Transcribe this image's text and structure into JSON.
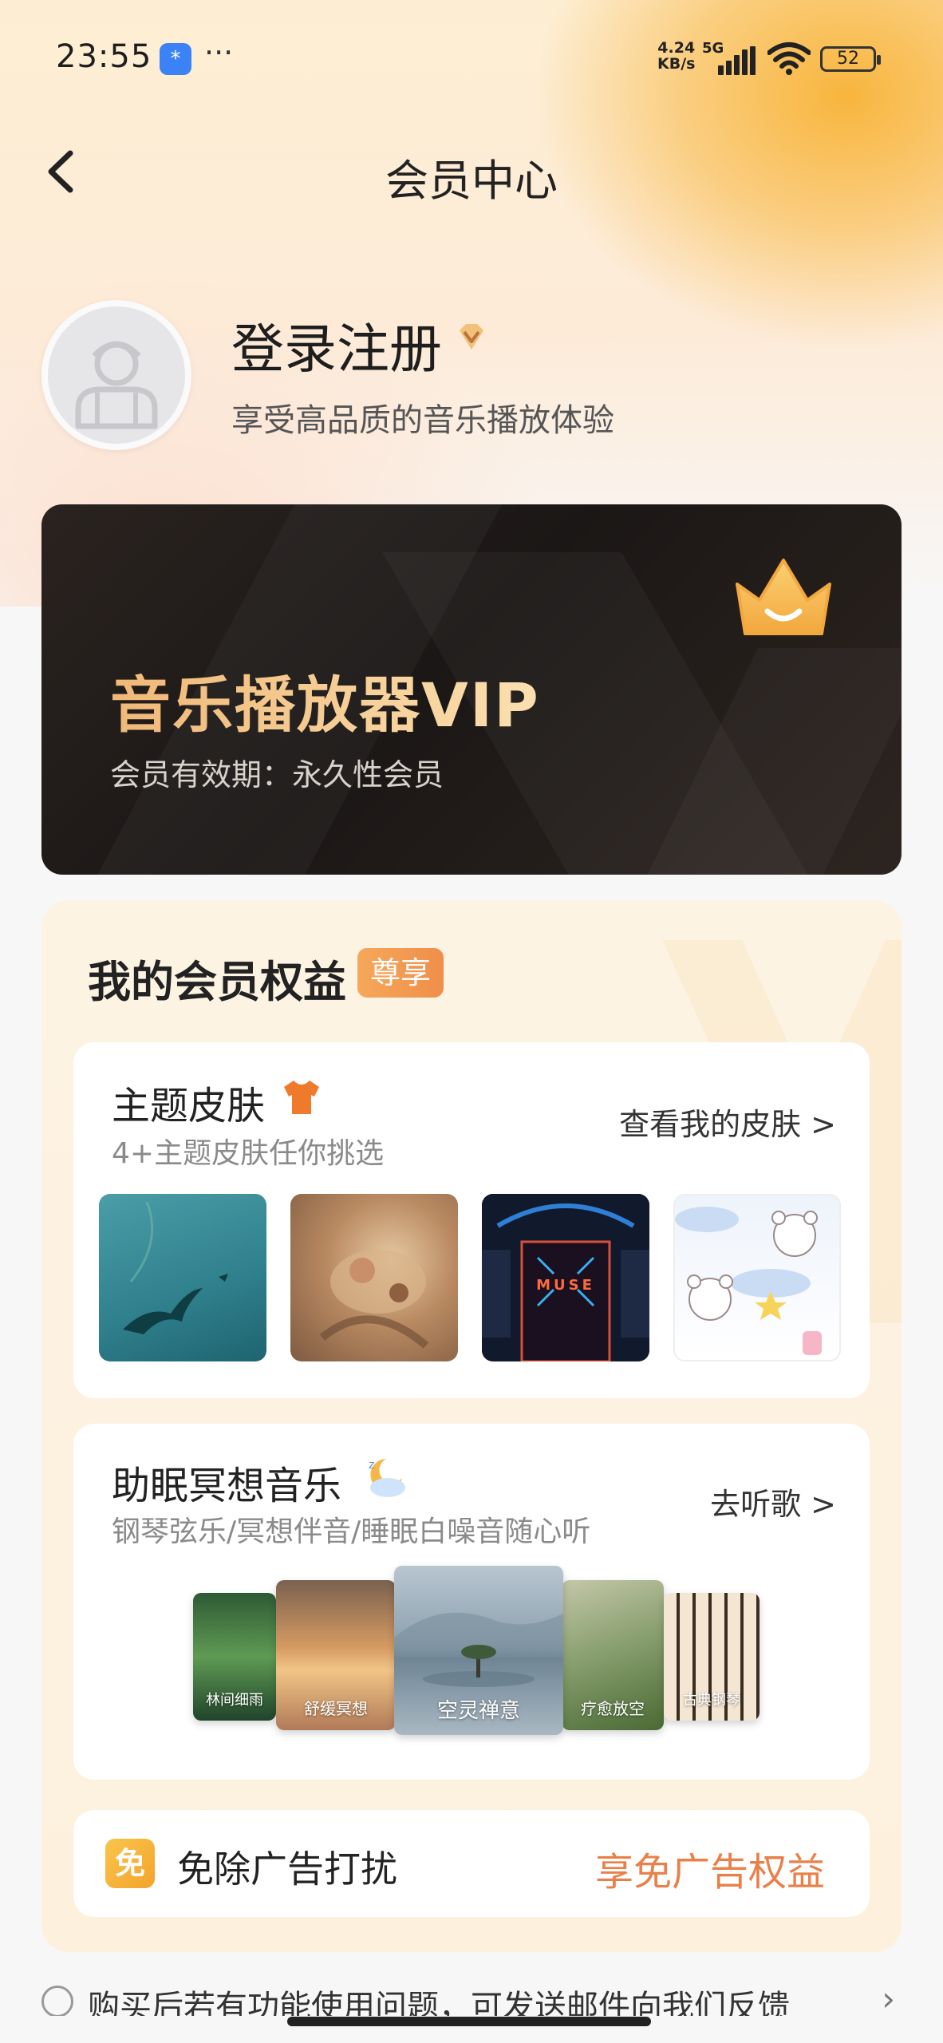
{
  "status_bar": {
    "time": "23:55",
    "dots": "···",
    "net_speed": "4.24",
    "net_unit": "KB/s",
    "network": "5G",
    "battery": "52",
    "app_icon": "*"
  },
  "header": {
    "title": "会员中心",
    "back_icon": "chevron-left-icon"
  },
  "profile": {
    "login_label": "登录注册",
    "subtitle": "享受高品质的音乐播放体验"
  },
  "vip_card": {
    "title": "音乐播放器VIP",
    "expiry": "会员有效期：永久性会员"
  },
  "benefits": {
    "title": "我的会员权益",
    "badge": "尊享",
    "skins": {
      "title": "主题皮肤",
      "subtitle": "4+主题皮肤任你挑选",
      "link": "查看我的皮肤 >",
      "thumbs_text": [
        "MUSE"
      ]
    },
    "sleep_music": {
      "title": "助眠冥想音乐",
      "subtitle": "钢琴弦乐/冥想伴音/睡眠白噪音随心听",
      "link": "去听歌 >",
      "covers": [
        "林间细雨",
        "舒缓冥想",
        "空灵禅意",
        "疗愈放空",
        "古典钢琴"
      ]
    },
    "ad_free": {
      "icon_text": "免",
      "label": "免除广告打扰",
      "link": "享免广告权益"
    }
  },
  "footer": {
    "tip": "购买后若有功能使用问题，可发送邮件向我们反馈"
  },
  "colors": {
    "accent_orange": "#e9804a",
    "vip_gold": "#f5c98a",
    "card_dark": "#1b1716"
  }
}
